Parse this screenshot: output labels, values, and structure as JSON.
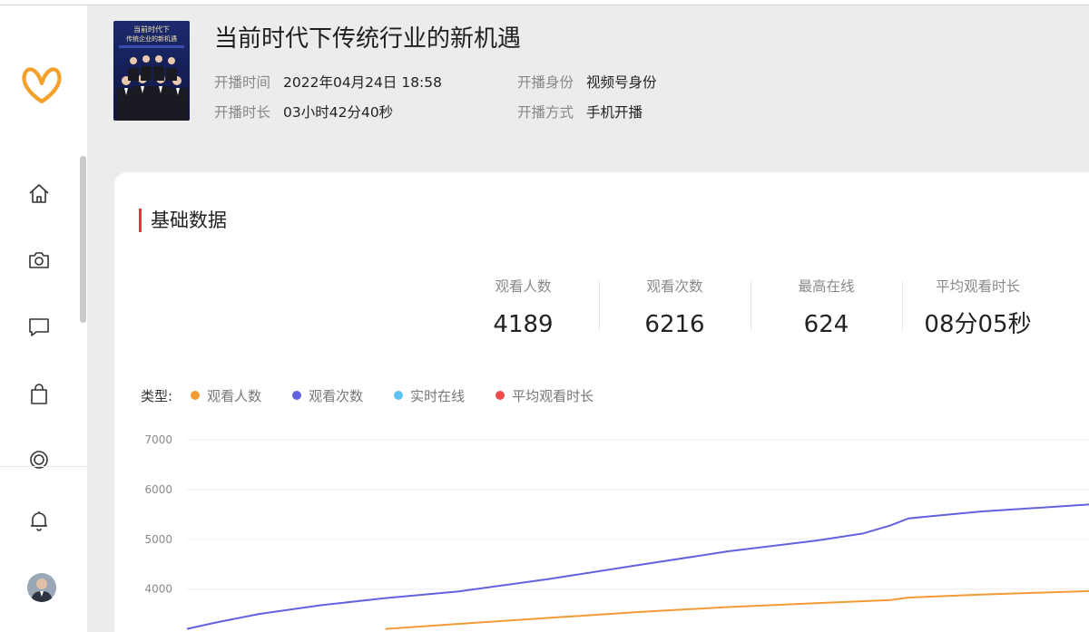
{
  "live": {
    "title": "当前时代下传统行业的新机遇",
    "cover_text": [
      "当前时代下",
      "传统企业的新机遇"
    ],
    "meta": [
      {
        "label": "开播时间",
        "value": "2022年04月24日 18:58"
      },
      {
        "label": "开播身份",
        "value": "视频号身份"
      },
      {
        "label": "开播时长",
        "value": "03小时42分40秒"
      },
      {
        "label": "开播方式",
        "value": "手机开播"
      }
    ]
  },
  "sidebar": {
    "icons": [
      "home-icon",
      "camera-icon",
      "message-icon",
      "shopping-bag-icon",
      "target-icon",
      "bell-icon"
    ]
  },
  "section": {
    "title": "基础数据"
  },
  "stats": [
    {
      "label": "观看人数",
      "value": "4189"
    },
    {
      "label": "观看次数",
      "value": "6216"
    },
    {
      "label": "最高在线",
      "value": "624"
    },
    {
      "label": "平均观看时长",
      "value": "08分05秒"
    }
  ],
  "legend": {
    "title": "类型:",
    "items": [
      {
        "name": "观看人数",
        "color": "#f39a34"
      },
      {
        "name": "观看次数",
        "color": "#6461e0"
      },
      {
        "name": "实时在线",
        "color": "#5dc3f2"
      },
      {
        "name": "平均观看时长",
        "color": "#ee4b4e"
      }
    ]
  },
  "colors": {
    "accent": "#e5343c",
    "logo": "#f5a02a"
  },
  "chart_data": {
    "type": "line",
    "y_ticks": [
      4000,
      5000,
      6000,
      7000
    ],
    "ylim": [
      3200,
      7000
    ],
    "xlim": [
      0,
      100
    ],
    "grid": true,
    "series": [
      {
        "name": "观看次数",
        "color": "#6461e0",
        "x": [
          0,
          3,
          8,
          15,
          22,
          30,
          40,
          50,
          60,
          70,
          75,
          78,
          80,
          88,
          100
        ],
        "values": [
          3200,
          3320,
          3500,
          3680,
          3820,
          3950,
          4200,
          4480,
          4760,
          4980,
          5120,
          5280,
          5420,
          5560,
          5700
        ]
      },
      {
        "name": "观看人数",
        "color": "#f39a34",
        "x": [
          22,
          30,
          40,
          50,
          60,
          70,
          78,
          80,
          88,
          100
        ],
        "values": [
          3200,
          3300,
          3420,
          3540,
          3640,
          3720,
          3780,
          3830,
          3890,
          3960
        ]
      }
    ]
  }
}
